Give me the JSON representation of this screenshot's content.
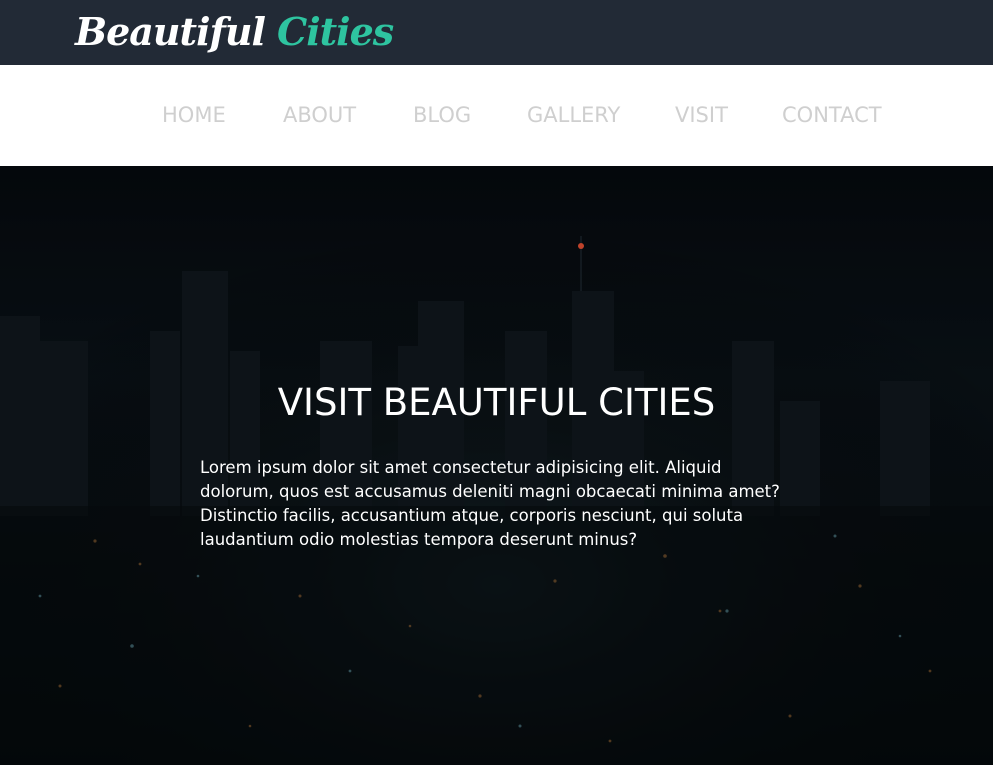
{
  "header": {
    "logo_word1": "Beautiful",
    "logo_word2": "Cities",
    "accent_color": "#2ec4a0",
    "background_color": "#222a36"
  },
  "nav": {
    "items": [
      {
        "label": "HOME"
      },
      {
        "label": "ABOUT"
      },
      {
        "label": "BLOG"
      },
      {
        "label": "GALLERY"
      },
      {
        "label": "VISIT"
      },
      {
        "label": "CONTACT"
      }
    ],
    "text_color": "#cfcfcf"
  },
  "hero": {
    "title": "VISIT BEAUTIFUL CITIES",
    "body": "Lorem ipsum dolor sit amet consectetur adipisicing elit. Aliquid dolorum, quos est accusamus deleniti magni obcaecati minima amet? Distinctio facilis, accusantium atque, corporis nesciunt, qui soluta laudantium odio molestias tempora deserunt minus?",
    "background": "night-city-skyline-photo"
  }
}
